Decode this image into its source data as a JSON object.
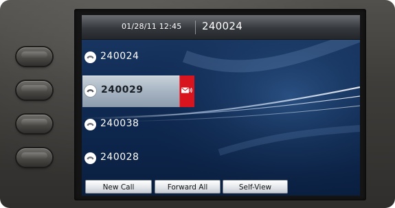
{
  "status_bar": {
    "datetime": "01/28/11 12:45",
    "primary_line": "240024"
  },
  "lines": [
    {
      "number": "240024",
      "icon": "handset-icon",
      "selected": false
    },
    {
      "number": "240029",
      "icon": "handset-icon",
      "selected": true,
      "badge_icon": "voicemail-icon",
      "badge_color": "#d8141f"
    },
    {
      "number": "240038",
      "icon": "handset-icon",
      "selected": false
    },
    {
      "number": "240028",
      "icon": "handset-icon",
      "selected": false
    }
  ],
  "softkeys": [
    {
      "label": "New Call"
    },
    {
      "label": "Forward All"
    },
    {
      "label": "Self-View"
    }
  ],
  "colors": {
    "background": "#0f2a53",
    "selected_row": "#a6b4c2",
    "voicemail_badge": "#d8141f",
    "softkey": "#e3e6ea"
  }
}
